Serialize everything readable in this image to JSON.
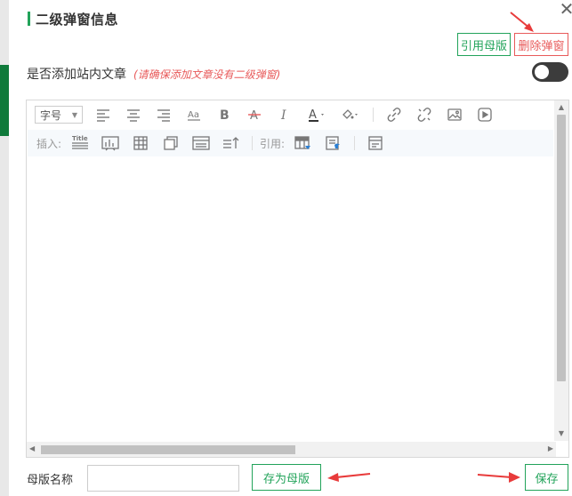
{
  "dialog": {
    "title": "二级弹窗信息",
    "close_icon": "close-icon"
  },
  "actions": {
    "cite_template": "引用母版",
    "delete_popup": "删除弹窗"
  },
  "toggle": {
    "label": "是否添加站内文章",
    "hint": "(请确保添加文章没有二级弹窗)",
    "state": "on"
  },
  "editor": {
    "toolbar1": {
      "font_size_label": "字号",
      "icons": [
        "align-left-icon",
        "align-center-icon",
        "align-right-icon",
        "font-case-icon",
        "bold-icon",
        "strikethrough-icon",
        "italic-icon",
        "font-color-icon",
        "background-color-icon",
        "link-icon",
        "unlink-icon",
        "image-icon",
        "video-icon"
      ]
    },
    "toolbar2": {
      "insert_label": "插入:",
      "cite_label": "引用:",
      "title_icon_text": "Title",
      "icons": [
        "title-icon",
        "chart-icon",
        "table-icon",
        "layer-icon",
        "panel-icon",
        "sort-icon",
        "cite-table-icon",
        "cite-doc-icon",
        "template-icon"
      ]
    },
    "content": ""
  },
  "footer": {
    "template_name_label": "母版名称",
    "template_name_value": "",
    "save_as_template": "存为母版",
    "save": "保存"
  },
  "colors": {
    "accent_green": "#22a35a",
    "danger_red": "#e85a5a",
    "annotation_arrow": "#e83b3b"
  }
}
